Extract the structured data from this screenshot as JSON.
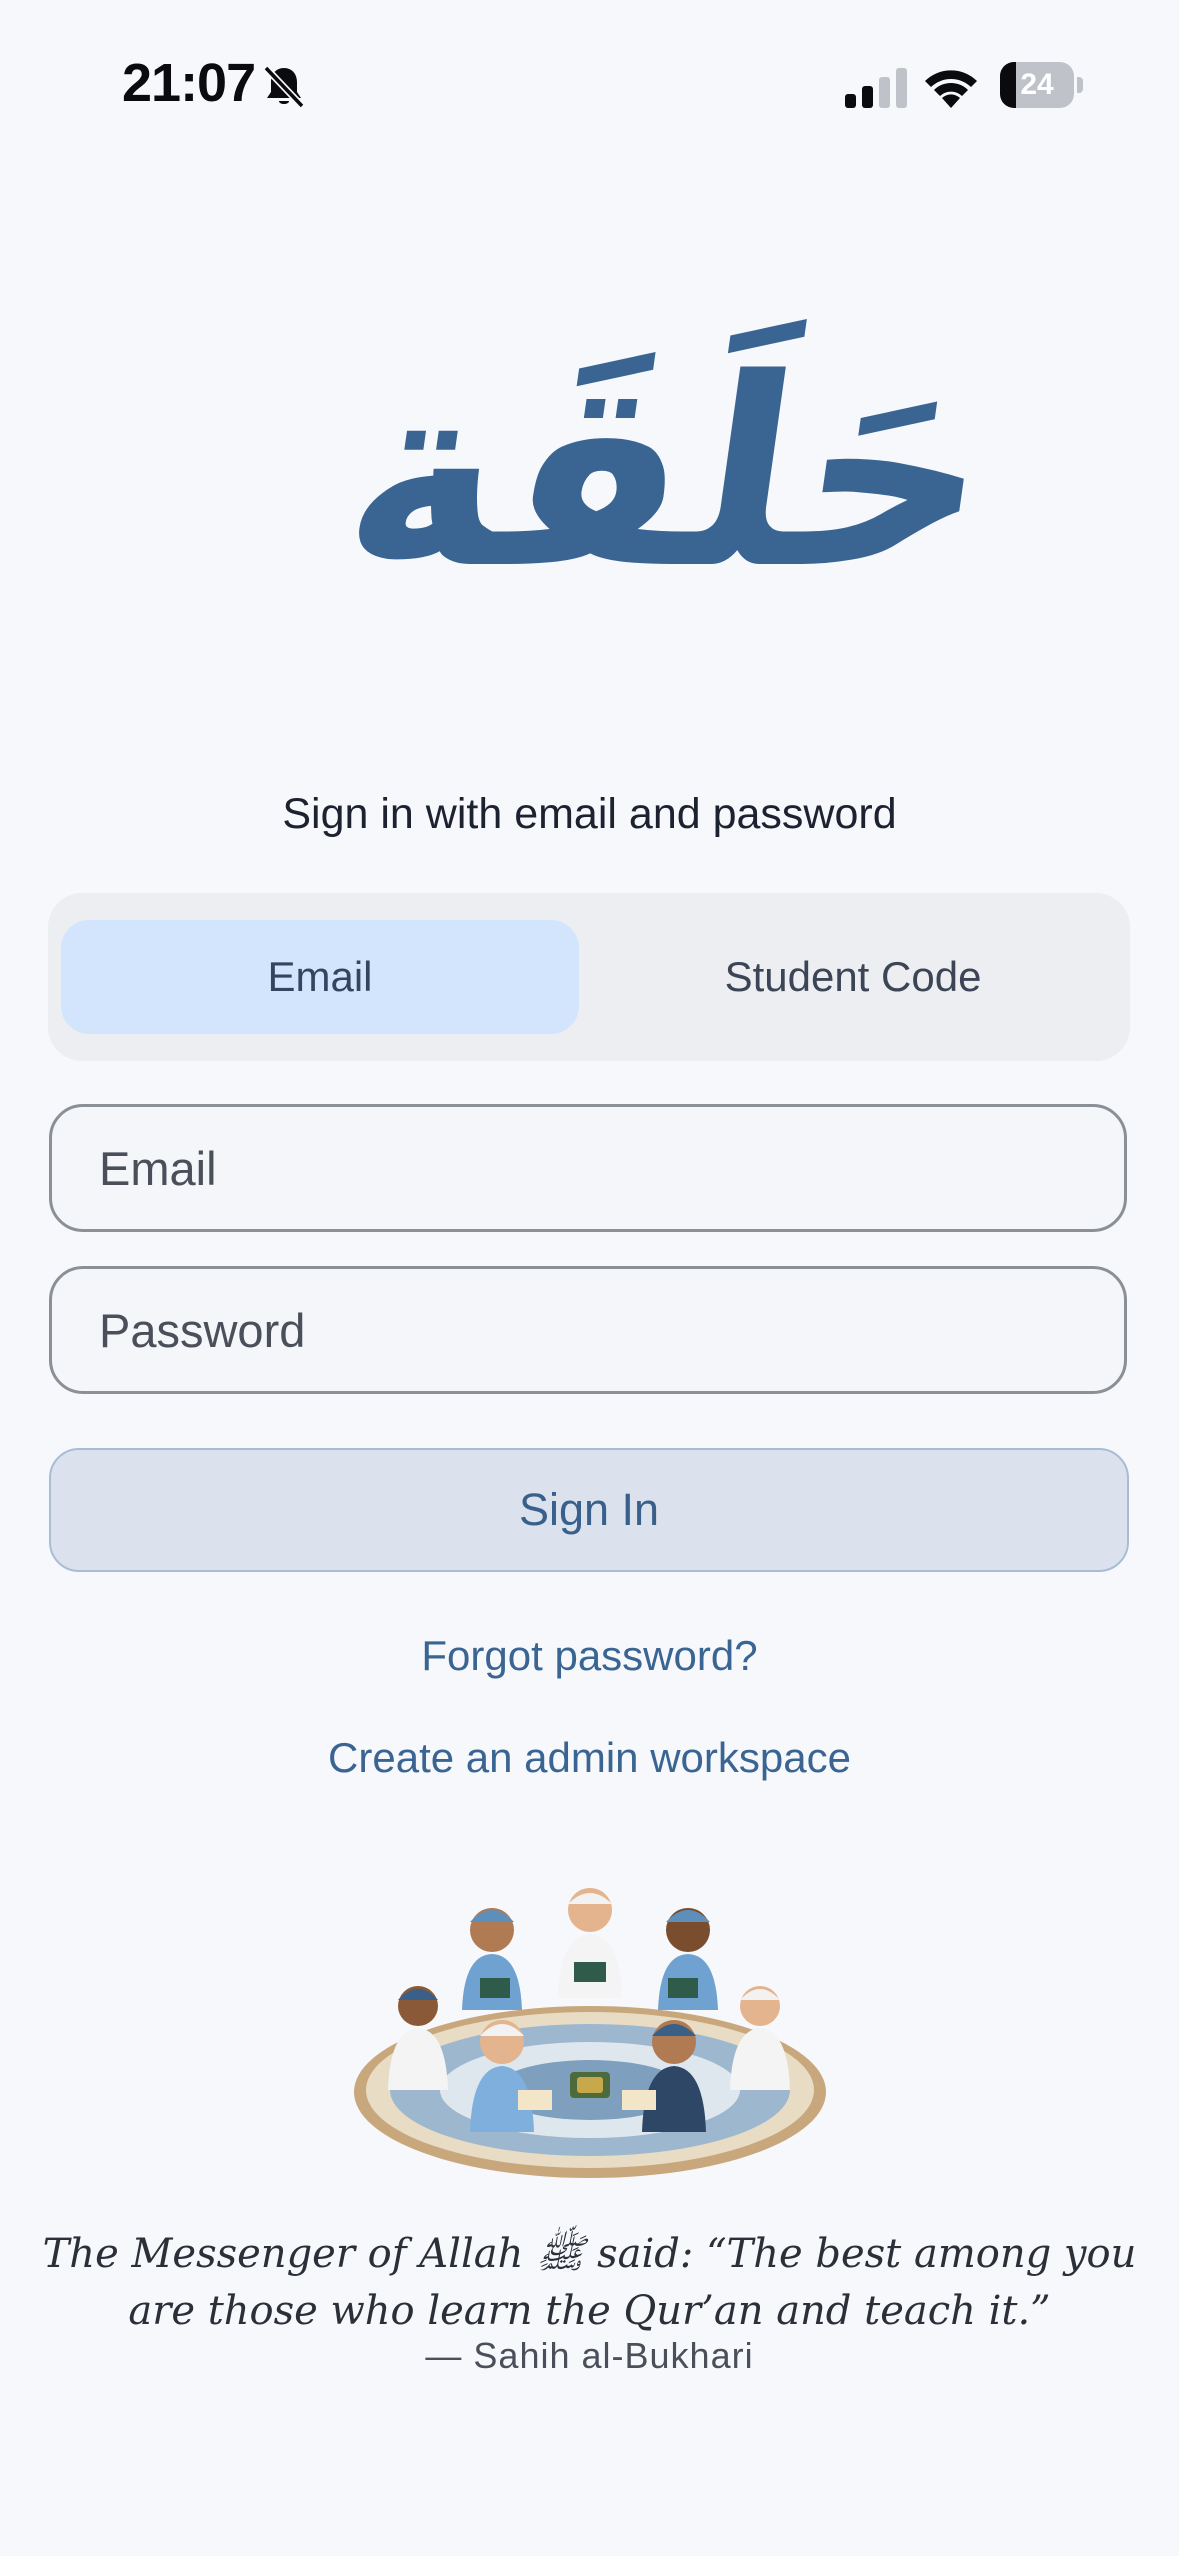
{
  "status_bar": {
    "time": "21:07",
    "battery_level": "24",
    "icons": [
      "bell-slash-icon",
      "cellular-signal-icon",
      "wifi-icon",
      "battery-icon"
    ]
  },
  "logo": {
    "text": "حَلَقَة"
  },
  "heading": "Sign in with email and password",
  "tabs": [
    {
      "label": "Email",
      "selected": true
    },
    {
      "label": "Student Code",
      "selected": false
    }
  ],
  "form": {
    "email_placeholder": "Email",
    "password_placeholder": "Password",
    "submit_label": "Sign In"
  },
  "links": {
    "forgot_password": "Forgot password?",
    "create_workspace": "Create an admin workspace"
  },
  "quote": {
    "text": "The Messenger of Allah ﷺ said: “The best among you are those who learn the Qur’an and teach it.”",
    "source": "— Sahih al-Bukhari"
  },
  "colors": {
    "background": "#f6f8fc",
    "accent": "#3a6592",
    "tab_selected": "#d3e5fc",
    "button_bg": "#dbe2ee"
  }
}
